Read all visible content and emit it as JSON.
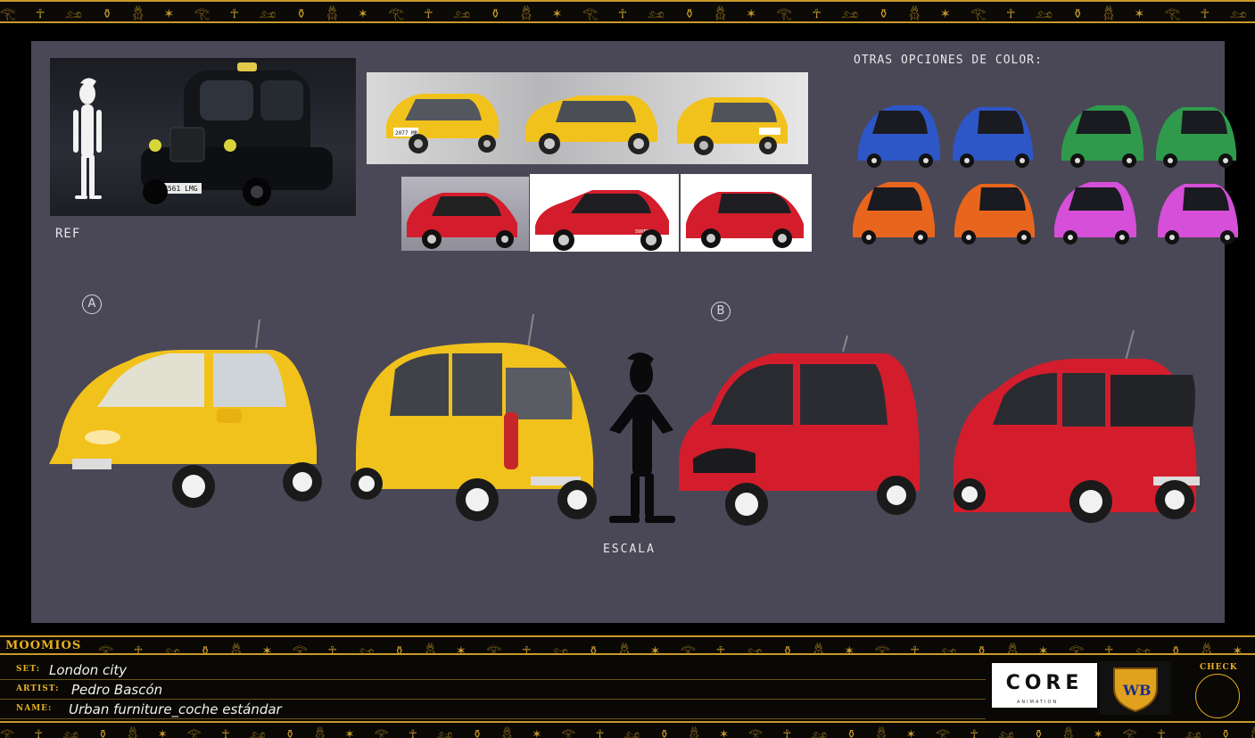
{
  "sheet": {
    "brand": "MOOMIOS",
    "labels": {
      "ref": "REF",
      "other_colors": "OTRAS OPCIONES DE COLOR:",
      "option_a": "A",
      "option_b": "B",
      "scale": "ESCALA"
    },
    "plates": {
      "seat": "2077 MR",
      "swift": "SWIFT",
      "taxi": "K561 LMG"
    }
  },
  "info": {
    "set_key": "SET:",
    "set_value": "London city",
    "artist_key": "ARTIST:",
    "artist_value": "Pedro Bascón",
    "name_key": "NAME:",
    "name_value": "Urban furniture_coche estándar",
    "check_label": "CHECK"
  },
  "logos": {
    "core": "CORE",
    "core_sub": "ANIMATION",
    "wb": "WB"
  },
  "colors": {
    "gold": "#c89a2a",
    "canvas": "#4a4857",
    "yellow_car": "#f2c21c",
    "red_car": "#d31d2c",
    "blue_car": "#2d56c6",
    "green_car": "#2f9a4c",
    "orange_car": "#e8651e",
    "pink_car": "#d54fd8"
  },
  "icons": {
    "glyph_band": "egyptian-hieroglyph-band"
  }
}
